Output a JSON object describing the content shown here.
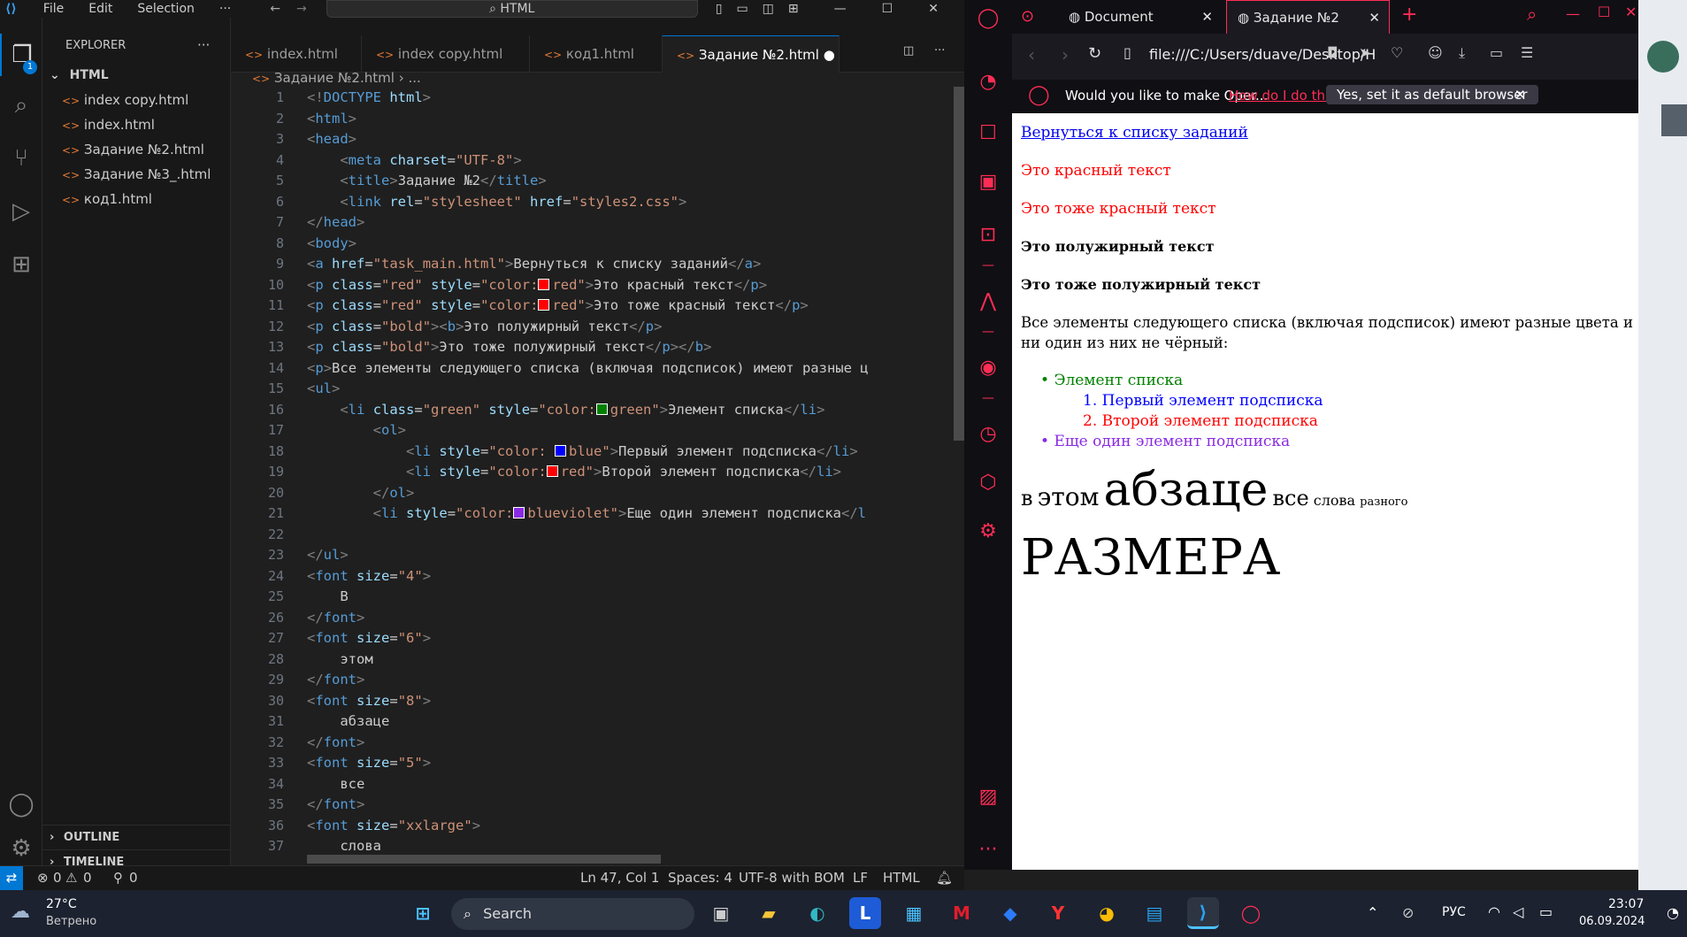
{
  "vscode": {
    "menu": [
      "File",
      "Edit",
      "Selection",
      "···"
    ],
    "command_center": "HTML",
    "sidebar": {
      "title": "EXPLORER",
      "folder": "HTML",
      "files": [
        "index copy.html",
        "index.html",
        "Задание №2.html",
        "Задание №3_.html",
        "код1.html"
      ],
      "outline": "OUTLINE",
      "timeline": "TIMELINE",
      "badge": "1"
    },
    "tabs": [
      "index.html",
      "index copy.html",
      "код1.html",
      "Задание №2.html"
    ],
    "breadcrumb": [
      "Задание №2.html",
      "..."
    ],
    "code": [
      [
        [
          "p",
          "<!"
        ],
        [
          "t",
          "DOCTYPE"
        ],
        [
          "x",
          " "
        ],
        [
          "a",
          "html"
        ],
        [
          "p",
          ">"
        ]
      ],
      [
        [
          "p",
          "<"
        ],
        [
          "t",
          "html"
        ],
        [
          "p",
          ">"
        ]
      ],
      [
        [
          "p",
          "<"
        ],
        [
          "t",
          "head"
        ],
        [
          "p",
          ">"
        ]
      ],
      [
        [
          "x",
          "    "
        ],
        [
          "p",
          "<"
        ],
        [
          "t",
          "meta"
        ],
        [
          "x",
          " "
        ],
        [
          "a",
          "charset"
        ],
        [
          "x",
          "="
        ],
        [
          "s",
          "\"UTF-8\""
        ],
        [
          "p",
          ">"
        ]
      ],
      [
        [
          "x",
          "    "
        ],
        [
          "p",
          "<"
        ],
        [
          "t",
          "title"
        ],
        [
          "p",
          ">"
        ],
        [
          "x",
          "Задание №2"
        ],
        [
          "p",
          "</"
        ],
        [
          "t",
          "title"
        ],
        [
          "p",
          ">"
        ]
      ],
      [
        [
          "x",
          "    "
        ],
        [
          "p",
          "<"
        ],
        [
          "t",
          "link"
        ],
        [
          "x",
          " "
        ],
        [
          "a",
          "rel"
        ],
        [
          "x",
          "="
        ],
        [
          "s",
          "\"stylesheet\""
        ],
        [
          "x",
          " "
        ],
        [
          "a",
          "href"
        ],
        [
          "x",
          "="
        ],
        [
          "s",
          "\"styles2.css\""
        ],
        [
          "p",
          ">"
        ]
      ],
      [
        [
          "p",
          "</"
        ],
        [
          "t",
          "head"
        ],
        [
          "p",
          ">"
        ]
      ],
      [
        [
          "p",
          "<"
        ],
        [
          "t",
          "body"
        ],
        [
          "p",
          ">"
        ]
      ],
      [
        [
          "p",
          "<"
        ],
        [
          "t",
          "a"
        ],
        [
          "x",
          " "
        ],
        [
          "a",
          "href"
        ],
        [
          "x",
          "="
        ],
        [
          "s",
          "\"task_main.html\""
        ],
        [
          "p",
          ">"
        ],
        [
          "x",
          "Вернуться к списку заданий"
        ],
        [
          "p",
          "</"
        ],
        [
          "t",
          "a"
        ],
        [
          "p",
          ">"
        ]
      ],
      [
        [
          "p",
          "<"
        ],
        [
          "t",
          "p"
        ],
        [
          "x",
          " "
        ],
        [
          "a",
          "class"
        ],
        [
          "x",
          "="
        ],
        [
          "s",
          "\"red\""
        ],
        [
          "x",
          " "
        ],
        [
          "a",
          "style"
        ],
        [
          "x",
          "="
        ],
        [
          "s",
          "\"color:"
        ],
        [
          "sw",
          "#ff0000"
        ],
        [
          "s",
          "red\""
        ],
        [
          "p",
          ">"
        ],
        [
          "x",
          "Это красный текст"
        ],
        [
          "p",
          "</"
        ],
        [
          "t",
          "p"
        ],
        [
          "p",
          ">"
        ]
      ],
      [
        [
          "p",
          "<"
        ],
        [
          "t",
          "p"
        ],
        [
          "x",
          " "
        ],
        [
          "a",
          "class"
        ],
        [
          "x",
          "="
        ],
        [
          "s",
          "\"red\""
        ],
        [
          "x",
          " "
        ],
        [
          "a",
          "style"
        ],
        [
          "x",
          "="
        ],
        [
          "s",
          "\"color:"
        ],
        [
          "sw",
          "#ff0000"
        ],
        [
          "s",
          "red\""
        ],
        [
          "p",
          ">"
        ],
        [
          "x",
          "Это тоже красный текст"
        ],
        [
          "p",
          "</"
        ],
        [
          "t",
          "p"
        ],
        [
          "p",
          ">"
        ]
      ],
      [
        [
          "p",
          "<"
        ],
        [
          "t",
          "p"
        ],
        [
          "x",
          " "
        ],
        [
          "a",
          "class"
        ],
        [
          "x",
          "="
        ],
        [
          "s",
          "\"bold\""
        ],
        [
          "p",
          ">"
        ],
        [
          "p",
          "<"
        ],
        [
          "t",
          "b"
        ],
        [
          "p",
          ">"
        ],
        [
          "x",
          "Это полужирный текст"
        ],
        [
          "p",
          "</"
        ],
        [
          "t",
          "p"
        ],
        [
          "p",
          ">"
        ]
      ],
      [
        [
          "p",
          "<"
        ],
        [
          "t",
          "p"
        ],
        [
          "x",
          " "
        ],
        [
          "a",
          "class"
        ],
        [
          "x",
          "="
        ],
        [
          "s",
          "\"bold\""
        ],
        [
          "p",
          ">"
        ],
        [
          "x",
          "Это тоже полужирный текст"
        ],
        [
          "p",
          "</"
        ],
        [
          "t",
          "p"
        ],
        [
          "p",
          ">"
        ],
        [
          "p",
          "</"
        ],
        [
          "t",
          "b"
        ],
        [
          "p",
          ">"
        ]
      ],
      [
        [
          "p",
          "<"
        ],
        [
          "t",
          "p"
        ],
        [
          "p",
          ">"
        ],
        [
          "x",
          "Все элементы следующего списка (включая подсписок) имеют разные ц"
        ]
      ],
      [
        [
          "p",
          "<"
        ],
        [
          "t",
          "ul"
        ],
        [
          "p",
          ">"
        ]
      ],
      [
        [
          "x",
          "    "
        ],
        [
          "p",
          "<"
        ],
        [
          "t",
          "li"
        ],
        [
          "x",
          " "
        ],
        [
          "a",
          "class"
        ],
        [
          "x",
          "="
        ],
        [
          "s",
          "\"green\""
        ],
        [
          "x",
          " "
        ],
        [
          "a",
          "style"
        ],
        [
          "x",
          "="
        ],
        [
          "s",
          "\"color:"
        ],
        [
          "sw",
          "#008000"
        ],
        [
          "s",
          "green\""
        ],
        [
          "p",
          ">"
        ],
        [
          "x",
          "Элемент списка"
        ],
        [
          "p",
          "</"
        ],
        [
          "t",
          "li"
        ],
        [
          "p",
          ">"
        ]
      ],
      [
        [
          "x",
          "        "
        ],
        [
          "p",
          "<"
        ],
        [
          "t",
          "ol"
        ],
        [
          "p",
          ">"
        ]
      ],
      [
        [
          "x",
          "            "
        ],
        [
          "p",
          "<"
        ],
        [
          "t",
          "li"
        ],
        [
          "x",
          " "
        ],
        [
          "a",
          "style"
        ],
        [
          "x",
          "="
        ],
        [
          "s",
          "\"color: "
        ],
        [
          "sw",
          "#0000ff"
        ],
        [
          "s",
          "blue\""
        ],
        [
          "p",
          ">"
        ],
        [
          "x",
          "Первый элемент подсписка"
        ],
        [
          "p",
          "</"
        ],
        [
          "t",
          "li"
        ],
        [
          "p",
          ">"
        ]
      ],
      [
        [
          "x",
          "            "
        ],
        [
          "p",
          "<"
        ],
        [
          "t",
          "li"
        ],
        [
          "x",
          " "
        ],
        [
          "a",
          "style"
        ],
        [
          "x",
          "="
        ],
        [
          "s",
          "\"color:"
        ],
        [
          "sw",
          "#ff0000"
        ],
        [
          "s",
          "red\""
        ],
        [
          "p",
          ">"
        ],
        [
          "x",
          "Второй элемент подсписка"
        ],
        [
          "p",
          "</"
        ],
        [
          "t",
          "li"
        ],
        [
          "p",
          ">"
        ]
      ],
      [
        [
          "x",
          "        "
        ],
        [
          "p",
          "</"
        ],
        [
          "t",
          "ol"
        ],
        [
          "p",
          ">"
        ]
      ],
      [
        [
          "x",
          "        "
        ],
        [
          "p",
          "<"
        ],
        [
          "t",
          "li"
        ],
        [
          "x",
          " "
        ],
        [
          "a",
          "style"
        ],
        [
          "x",
          "="
        ],
        [
          "s",
          "\"color:"
        ],
        [
          "sw",
          "#8a2be2"
        ],
        [
          "s",
          "blueviolet\""
        ],
        [
          "p",
          ">"
        ],
        [
          "x",
          "Еще один элемент подсписка"
        ],
        [
          "p",
          "</"
        ],
        [
          "t",
          "l"
        ]
      ],
      [],
      [
        [
          "p",
          "</"
        ],
        [
          "t",
          "ul"
        ],
        [
          "p",
          ">"
        ]
      ],
      [
        [
          "p",
          "<"
        ],
        [
          "t",
          "font"
        ],
        [
          "x",
          " "
        ],
        [
          "a",
          "size"
        ],
        [
          "x",
          "="
        ],
        [
          "s",
          "\"4\""
        ],
        [
          "p",
          ">"
        ]
      ],
      [
        [
          "x",
          "    "
        ],
        [
          "x",
          "В"
        ]
      ],
      [
        [
          "p",
          "</"
        ],
        [
          "t",
          "font"
        ],
        [
          "p",
          ">"
        ]
      ],
      [
        [
          "p",
          "<"
        ],
        [
          "t",
          "font"
        ],
        [
          "x",
          " "
        ],
        [
          "a",
          "size"
        ],
        [
          "x",
          "="
        ],
        [
          "s",
          "\"6\""
        ],
        [
          "p",
          ">"
        ]
      ],
      [
        [
          "x",
          "    "
        ],
        [
          "x",
          "этом"
        ]
      ],
      [
        [
          "p",
          "</"
        ],
        [
          "t",
          "font"
        ],
        [
          "p",
          ">"
        ]
      ],
      [
        [
          "p",
          "<"
        ],
        [
          "t",
          "font"
        ],
        [
          "x",
          " "
        ],
        [
          "a",
          "size"
        ],
        [
          "x",
          "="
        ],
        [
          "s",
          "\"8\""
        ],
        [
          "p",
          ">"
        ]
      ],
      [
        [
          "x",
          "    "
        ],
        [
          "x",
          "абзаце"
        ]
      ],
      [
        [
          "p",
          "</"
        ],
        [
          "t",
          "font"
        ],
        [
          "p",
          ">"
        ]
      ],
      [
        [
          "p",
          "<"
        ],
        [
          "t",
          "font"
        ],
        [
          "x",
          " "
        ],
        [
          "a",
          "size"
        ],
        [
          "x",
          "="
        ],
        [
          "s",
          "\"5\""
        ],
        [
          "p",
          ">"
        ]
      ],
      [
        [
          "x",
          "    "
        ],
        [
          "x",
          "все"
        ]
      ],
      [
        [
          "p",
          "</"
        ],
        [
          "t",
          "font"
        ],
        [
          "p",
          ">"
        ]
      ],
      [
        [
          "p",
          "<"
        ],
        [
          "t",
          "font"
        ],
        [
          "x",
          " "
        ],
        [
          "a",
          "size"
        ],
        [
          "x",
          "="
        ],
        [
          "s",
          "\"xxlarge\""
        ],
        [
          "p",
          ">"
        ]
      ],
      [
        [
          "x",
          "    "
        ],
        [
          "x",
          "слова"
        ]
      ]
    ],
    "status": {
      "errors": "0",
      "warnings": "0",
      "ports": "0",
      "position": "Ln 47, Col 1",
      "spaces": "Spaces: 4",
      "encoding": "UTF-8 with BOM",
      "eol": "LF",
      "language": "HTML"
    }
  },
  "opera": {
    "tabs": [
      "Document",
      "Задание №2"
    ],
    "url": "file:///C:/Users/duave/Desktop/H",
    "banner_text": "Would you like to make Oper...",
    "banner_link": "How do I do that?",
    "banner_button": "Yes, set it as default browser",
    "page": {
      "link": "Вернуться к списку заданий",
      "red1": "Это красный текст",
      "red2": "Это тоже красный текст",
      "bold1": "Это полужирный текст",
      "bold2": "Это тоже полужирный текст",
      "para_line1": "Все элементы следующего списка (включая подсписок) имеют разные цвета и",
      "para_line2": "ни один из них не чёрный:",
      "li1": "Элемент списка",
      "ol1": "1. Первый элемент подсписка",
      "ol2": "2. Второй элемент подсписка",
      "li2": "Еще один элемент подсписка",
      "w1": "в",
      "w2": "этом",
      "w3": "абзаце",
      "w4": "все",
      "w5": "слова",
      "w6": "разного",
      "w7": "РАЗМЕРА"
    }
  },
  "taskbar": {
    "temp": "27°C",
    "weather": "Ветрено",
    "search": "Search",
    "lang": "РУС",
    "time": "23:07",
    "date": "06.09.2024"
  },
  "colors": {
    "accent": "#0078d4",
    "opera_red": "#ff2d55",
    "link": "#0000ee"
  }
}
